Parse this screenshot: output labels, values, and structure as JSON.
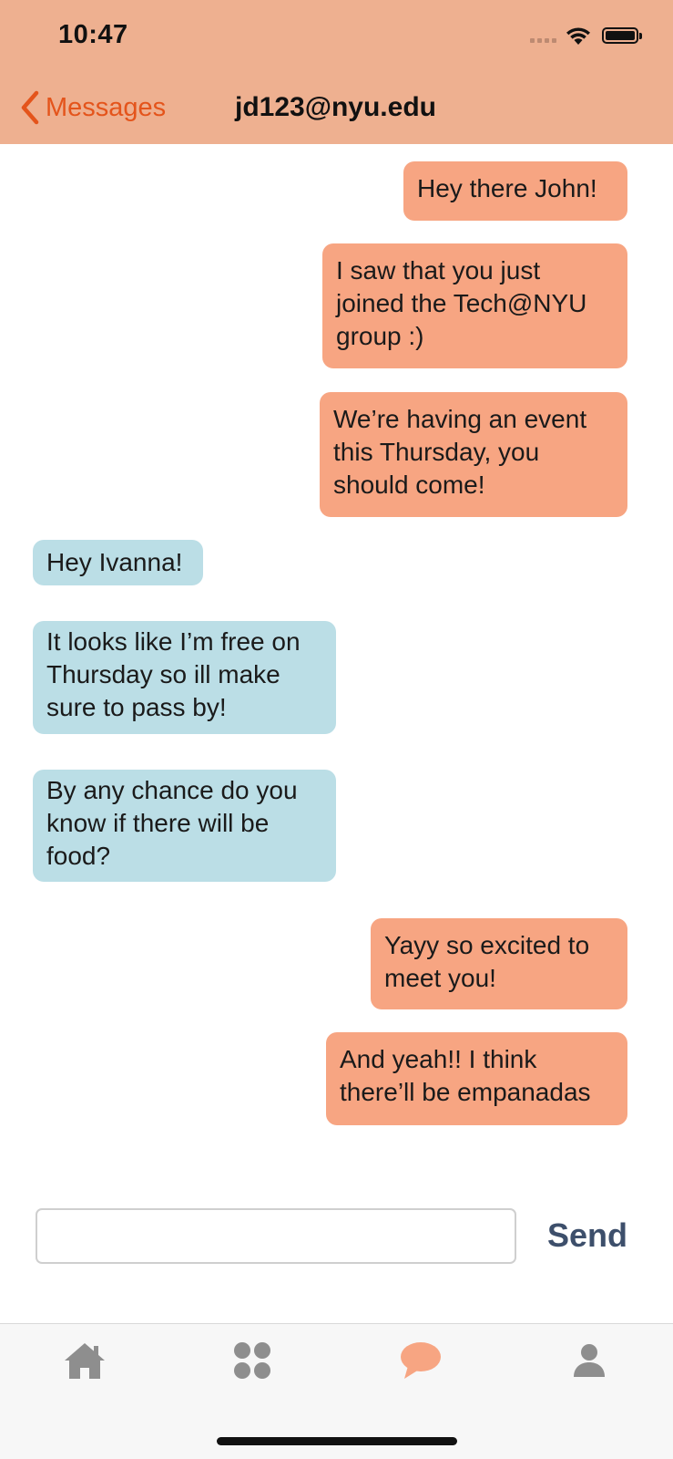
{
  "status_bar": {
    "time": "10:47"
  },
  "nav": {
    "back_label": "Messages",
    "title": "jd123@nyu.edu"
  },
  "messages": [
    {
      "sender": "me",
      "text": "Hey there John!"
    },
    {
      "sender": "me",
      "text": "I saw that you just\njoined the Tech@NYU\ngroup :)"
    },
    {
      "sender": "me",
      "text": "We’re having an event\nthis Thursday, you\nshould come!"
    },
    {
      "sender": "other",
      "text": "Hey Ivanna!"
    },
    {
      "sender": "other",
      "text": "It looks like I’m free on\nThursday so ill make\nsure to pass by!"
    },
    {
      "sender": "other",
      "text": "By any chance do you\nknow if there will be\nfood?"
    },
    {
      "sender": "me",
      "text": "Yayy so excited to\nmeet you!"
    },
    {
      "sender": "me",
      "text": "And yeah!! I think\nthere’ll be empanadas"
    }
  ],
  "composer": {
    "input_value": "",
    "placeholder": "",
    "send_label": "Send"
  },
  "tabbar": {
    "tabs": [
      {
        "icon": "home-icon",
        "active": false
      },
      {
        "icon": "groups-icon",
        "active": false
      },
      {
        "icon": "chat-icon",
        "active": true
      },
      {
        "icon": "profile-icon",
        "active": false
      }
    ]
  },
  "colors": {
    "header_bg": "#EEB090",
    "accent": "#E4541B",
    "sent_bubble": "#F7A582",
    "received_bubble": "#BBDEE6",
    "send_button": "#3D4F6B",
    "tab_inactive": "#8E8E8E",
    "tab_active": "#F7A582"
  }
}
